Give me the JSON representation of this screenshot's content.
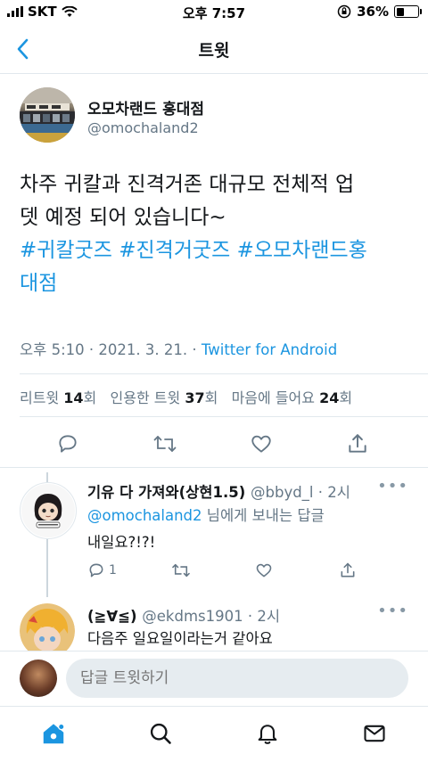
{
  "status_bar": {
    "carrier": "SKT",
    "time": "오후 7:57",
    "battery_percent": "36%",
    "battery_level": 0.36
  },
  "nav": {
    "title": "트윗"
  },
  "tweet": {
    "author_name": "오모차랜드 홍대점",
    "author_handle": "@omochaland2",
    "text_line1": "차주 귀칼과 진격거존 대규모 전체적 업",
    "text_line2": "뎃 예정 되어 있습니다~",
    "hashtags_line1": "#귀칼굿즈 #진격거굿즈 #오모차랜드홍",
    "hashtags_line2": "대점",
    "time": "오후 5:10",
    "date": "2021. 3. 21.",
    "source": "Twitter for Android",
    "stats": {
      "retweets_label": "리트윗",
      "retweets_count": "14",
      "retweets_unit": "회",
      "quotes_label": "인용한 트윗",
      "quotes_count": "37",
      "quotes_unit": "회",
      "likes_label": "마음에 들어요",
      "likes_count": "24",
      "likes_unit": "회"
    }
  },
  "replies": [
    {
      "name": "기유 다 가져와(상현1.5)",
      "handle": "@bbyd_l",
      "time": "2시",
      "replying_to": "@omochaland2",
      "replying_suffix": "님에게 보내는 답글",
      "text": "내일요?!?!",
      "reply_count": "1"
    },
    {
      "name": "(≧∀≦)",
      "handle": "@ekdms1901",
      "time": "2시",
      "text": "다음주 일요일이라는거 같아요"
    }
  ],
  "compose": {
    "placeholder": "답글 트윗하기"
  },
  "colors": {
    "accent": "#1b95e0",
    "secondary_text": "#657786",
    "divider": "#e1e8ed"
  },
  "icons": [
    "signal-icon",
    "wifi-icon",
    "orientation-lock-icon",
    "battery-icon",
    "back-chevron-icon",
    "reply-icon",
    "retweet-icon",
    "like-icon",
    "share-icon",
    "more-icon",
    "home-icon",
    "search-icon",
    "notifications-icon",
    "messages-icon"
  ]
}
